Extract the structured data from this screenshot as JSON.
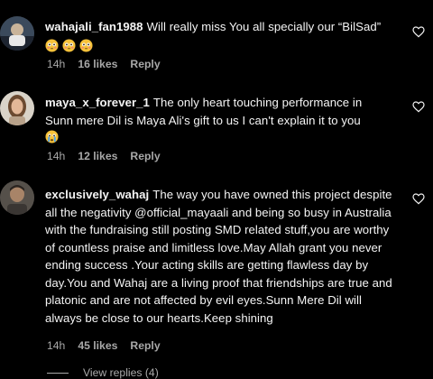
{
  "colors": {
    "background": "#000000",
    "text": "#f5f5f5",
    "muted": "#a8a8a8"
  },
  "comments": [
    {
      "username": "wahajali_fan1988",
      "text": "Will really miss You all specially our “BilSad”",
      "emojis": [
        "flushed-face",
        "flushed-face",
        "flushed-face"
      ],
      "time": "14h",
      "likes": "16 likes",
      "reply": "Reply",
      "avatar_icon": "avatar-photo-icon"
    },
    {
      "username": "maya_x_forever_1",
      "text": "The only heart touching performance in Sunn mere Dil is Maya Ali's gift to us I can't explain it to you",
      "emojis": [
        "crying-face"
      ],
      "time": "14h",
      "likes": "12 likes",
      "reply": "Reply",
      "avatar_icon": "avatar-photo-icon"
    },
    {
      "username": "exclusively_wahaj",
      "text": "The way you have owned this project despite all the negativity @official_mayaali and being so busy in Australia with the fundraising still posting SMD related stuff,you are worthy of countless praise and limitless love.May Allah grant you never ending success .Your acting skills are getting flawless day by day.You and Wahaj are a living proof that friendships are true and platonic and are not affected by evil eyes.Sunn Mere Dil will always be close to our hearts.Keep shining",
      "emojis": [],
      "time": "14h",
      "likes": "45 likes",
      "reply": "Reply",
      "avatar_icon": "avatar-photo-icon"
    }
  ],
  "view_replies": "View replies (4)"
}
